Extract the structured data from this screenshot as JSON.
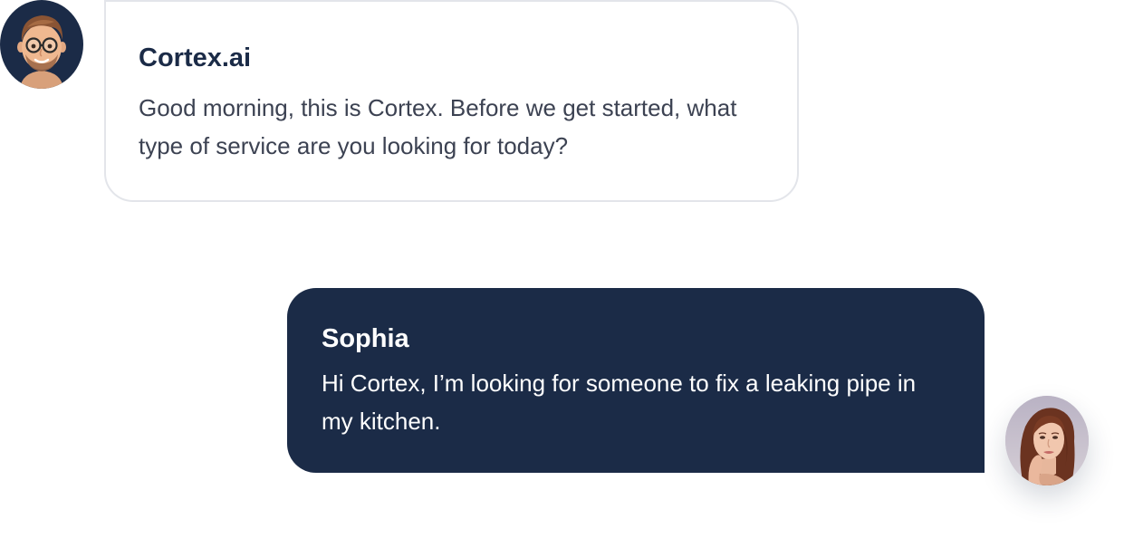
{
  "chat": {
    "messages": [
      {
        "sender": "Cortex.ai",
        "text": "Good morning, this is Cortex. Before we get started, what type of service are you looking for today?",
        "avatar_icon": "memoji-man-glasses-icon"
      },
      {
        "sender": "Sophia",
        "text": "Hi Cortex, I’m looking for someone to fix a leaking pipe in my kitchen.",
        "avatar_icon": "woman-portrait-icon"
      }
    ]
  },
  "colors": {
    "navy": "#1b2b47",
    "bubble_border": "#e3e5ea",
    "bot_text": "#3c4252",
    "user_text": "#ffffff",
    "background": "#ffffff"
  }
}
